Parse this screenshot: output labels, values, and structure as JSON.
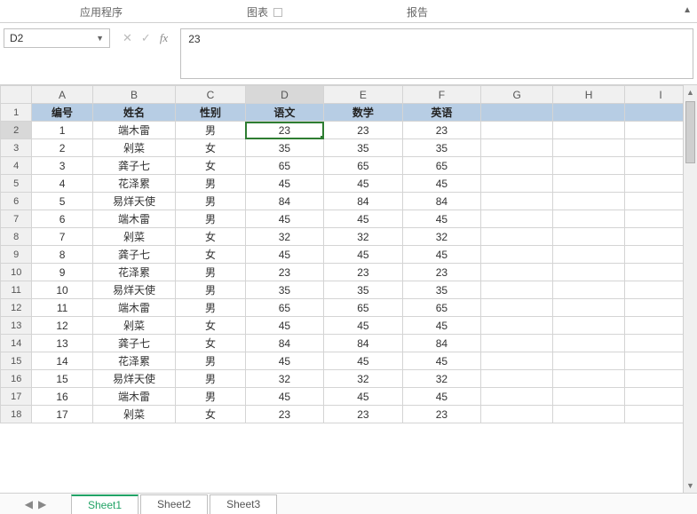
{
  "ribbon": {
    "group1": "应用程序",
    "group2": "图表",
    "group3": "报告"
  },
  "namebox": {
    "value": "D2"
  },
  "formula": {
    "value": "23"
  },
  "columns": [
    "A",
    "B",
    "C",
    "D",
    "E",
    "F",
    "G",
    "H",
    "I"
  ],
  "active_col": "D",
  "active_row": 2,
  "headers": [
    "编号",
    "姓名",
    "性别",
    "语文",
    "数学",
    "英语"
  ],
  "rows": [
    {
      "n": "1",
      "name": "端木雷",
      "sex": "男",
      "c1": "23",
      "c2": "23",
      "c3": "23"
    },
    {
      "n": "2",
      "name": "剁菜",
      "sex": "女",
      "c1": "35",
      "c2": "35",
      "c3": "35"
    },
    {
      "n": "3",
      "name": "龚子七",
      "sex": "女",
      "c1": "65",
      "c2": "65",
      "c3": "65"
    },
    {
      "n": "4",
      "name": "花泽累",
      "sex": "男",
      "c1": "45",
      "c2": "45",
      "c3": "45"
    },
    {
      "n": "5",
      "name": "易烊天使",
      "sex": "男",
      "c1": "84",
      "c2": "84",
      "c3": "84"
    },
    {
      "n": "6",
      "name": "端木雷",
      "sex": "男",
      "c1": "45",
      "c2": "45",
      "c3": "45"
    },
    {
      "n": "7",
      "name": "剁菜",
      "sex": "女",
      "c1": "32",
      "c2": "32",
      "c3": "32"
    },
    {
      "n": "8",
      "name": "龚子七",
      "sex": "女",
      "c1": "45",
      "c2": "45",
      "c3": "45"
    },
    {
      "n": "9",
      "name": "花泽累",
      "sex": "男",
      "c1": "23",
      "c2": "23",
      "c3": "23"
    },
    {
      "n": "10",
      "name": "易烊天使",
      "sex": "男",
      "c1": "35",
      "c2": "35",
      "c3": "35"
    },
    {
      "n": "11",
      "name": "端木雷",
      "sex": "男",
      "c1": "65",
      "c2": "65",
      "c3": "65"
    },
    {
      "n": "12",
      "name": "剁菜",
      "sex": "女",
      "c1": "45",
      "c2": "45",
      "c3": "45"
    },
    {
      "n": "13",
      "name": "龚子七",
      "sex": "女",
      "c1": "84",
      "c2": "84",
      "c3": "84"
    },
    {
      "n": "14",
      "name": "花泽累",
      "sex": "男",
      "c1": "45",
      "c2": "45",
      "c3": "45"
    },
    {
      "n": "15",
      "name": "易烊天使",
      "sex": "男",
      "c1": "32",
      "c2": "32",
      "c3": "32"
    },
    {
      "n": "16",
      "name": "端木雷",
      "sex": "男",
      "c1": "45",
      "c2": "45",
      "c3": "45"
    },
    {
      "n": "17",
      "name": "剁菜",
      "sex": "女",
      "c1": "23",
      "c2": "23",
      "c3": "23"
    }
  ],
  "tabs": [
    "Sheet1",
    "Sheet2",
    "Sheet3"
  ],
  "active_tab": 0
}
